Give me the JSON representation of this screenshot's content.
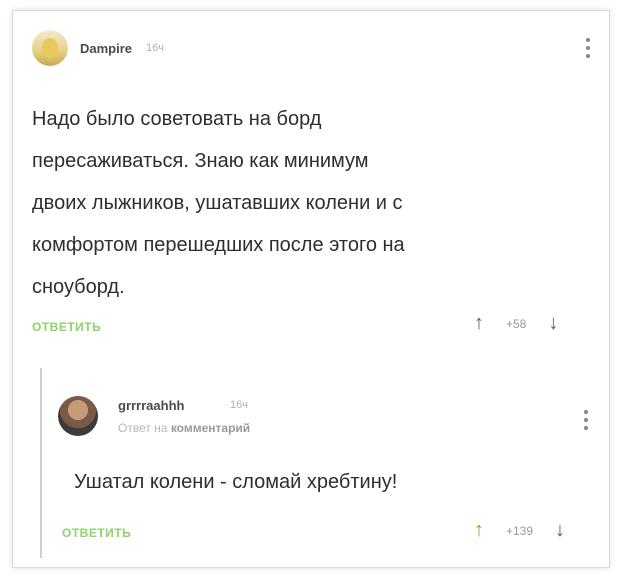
{
  "comments": [
    {
      "author": "Dampire",
      "time": "16ч",
      "text_lines": [
        "Надо было советовать на борд",
        "пересаживаться. Знаю как минимум",
        "двоих лыжников, ушатавших колени и  с",
        "комфортом перешедших после этого на",
        "сноуборд."
      ],
      "reply_label": "ОТВЕТИТЬ",
      "score": "+58",
      "upvote_icon": "↑",
      "downvote_icon": "↓"
    },
    {
      "author": "grrrraahhh",
      "time": "16ч",
      "reply_to_prefix": "Ответ на",
      "reply_to_target": "комментарий",
      "text": "Ушатал колени - сломай хребтину!",
      "reply_label": "ОТВЕТИТЬ",
      "score": "+139",
      "upvote_icon": "↑",
      "downvote_icon": "↓"
    }
  ],
  "colors": {
    "accent_green": "#8bd36a",
    "upvote_active": "#5cbf2a",
    "text": "#2e2e2e",
    "muted": "#b0b0b0"
  }
}
